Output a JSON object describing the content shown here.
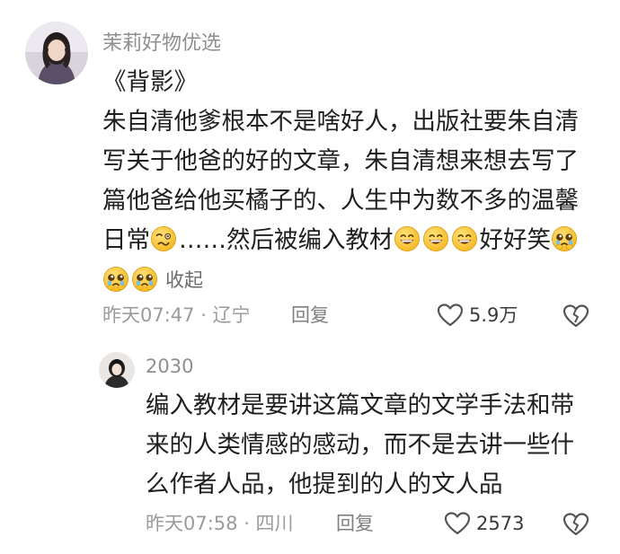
{
  "main_comment": {
    "username": "茉莉好物优选",
    "body_lines": [
      "《背影》",
      "朱自清他爹根本不是啥好人，出版社要朱自清",
      "写关于他爸的好的文章，朱自清想来想去写了",
      "篇他爸给他买橘子的、人生中为数不多的温馨"
    ],
    "line5_part1": "日常",
    "line5_part2": "……然后被编入教材",
    "line5_part3": "好好笑",
    "collapse_label": "收起",
    "time_location": "昨天07:47 · 辽宁",
    "reply_label": "回复",
    "like_count": "5.9万",
    "emojis": [
      "woozy-face-icon",
      "grinning-face-icon",
      "pleading-face-icon"
    ]
  },
  "reply_comment": {
    "username": "2030",
    "body_lines": [
      "编入教材是要讲这篇文章的文学手法和带",
      "来的人类情感的感动，而不是去讲一些什",
      "么作者人品，他提到的人的文人品"
    ],
    "time_location": "昨天07:58 · 四川",
    "reply_label": "回复",
    "like_count": "2573"
  },
  "colors": {
    "text_primary": "#1f1f1f",
    "text_secondary": "#8f8f8f",
    "emoji_yellow": "#f7c631"
  }
}
